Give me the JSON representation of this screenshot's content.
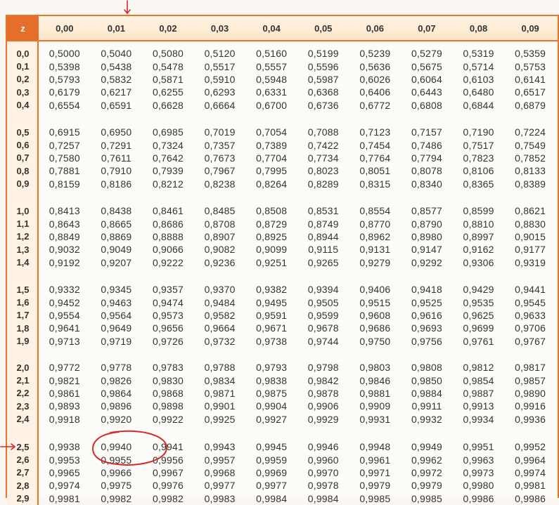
{
  "header": {
    "z_label": "z",
    "columns": [
      "0,00",
      "0,01",
      "0,02",
      "0,03",
      "0,04",
      "0,05",
      "0,06",
      "0,07",
      "0,08",
      "0,09"
    ]
  },
  "groups": [
    {
      "rows": [
        {
          "z": "0,0",
          "values": [
            "0,5000",
            "0,5040",
            "0,5080",
            "0,5120",
            "0,5160",
            "0,5199",
            "0,5239",
            "0,5279",
            "0,5319",
            "0,5359"
          ]
        },
        {
          "z": "0,1",
          "values": [
            "0,5398",
            "0,5438",
            "0,5478",
            "0,5517",
            "0,5557",
            "0,5596",
            "0,5636",
            "0,5675",
            "0,5714",
            "0,5753"
          ]
        },
        {
          "z": "0,2",
          "values": [
            "0,5793",
            "0,5832",
            "0,5871",
            "0,5910",
            "0,5948",
            "0,5987",
            "0,6026",
            "0,6064",
            "0,6103",
            "0,6141"
          ]
        },
        {
          "z": "0,3",
          "values": [
            "0,6179",
            "0,6217",
            "0,6255",
            "0,6293",
            "0,6331",
            "0,6368",
            "0,6406",
            "0,6443",
            "0,6480",
            "0,6517"
          ]
        },
        {
          "z": "0,4",
          "values": [
            "0,6554",
            "0,6591",
            "0,6628",
            "0,6664",
            "0,6700",
            "0,6736",
            "0,6772",
            "0,6808",
            "0,6844",
            "0,6879"
          ]
        }
      ]
    },
    {
      "rows": [
        {
          "z": "0,5",
          "values": [
            "0,6915",
            "0,6950",
            "0,6985",
            "0,7019",
            "0,7054",
            "0,7088",
            "0,7123",
            "0,7157",
            "0,7190",
            "0,7224"
          ]
        },
        {
          "z": "0,6",
          "values": [
            "0,7257",
            "0,7291",
            "0,7324",
            "0,7357",
            "0,7389",
            "0,7422",
            "0,7454",
            "0,7486",
            "0,7517",
            "0,7549"
          ]
        },
        {
          "z": "0,7",
          "values": [
            "0,7580",
            "0,7611",
            "0,7642",
            "0,7673",
            "0,7704",
            "0,7734",
            "0,7764",
            "0,7794",
            "0,7823",
            "0,7852"
          ]
        },
        {
          "z": "0,8",
          "values": [
            "0,7881",
            "0,7910",
            "0,7939",
            "0,7967",
            "0,7995",
            "0,8023",
            "0,8051",
            "0,8078",
            "0,8106",
            "0,8133"
          ]
        },
        {
          "z": "0,9",
          "values": [
            "0,8159",
            "0,8186",
            "0,8212",
            "0,8238",
            "0,8264",
            "0,8289",
            "0,8315",
            "0,8340",
            "0,8365",
            "0,8389"
          ]
        }
      ]
    },
    {
      "rows": [
        {
          "z": "1,0",
          "values": [
            "0,8413",
            "0,8438",
            "0,8461",
            "0,8485",
            "0,8508",
            "0,8531",
            "0,8554",
            "0,8577",
            "0,8599",
            "0,8621"
          ]
        },
        {
          "z": "1,1",
          "values": [
            "0,8643",
            "0,8665",
            "0,8686",
            "0,8708",
            "0,8729",
            "0,8749",
            "0,8770",
            "0,8790",
            "0,8810",
            "0,8830"
          ]
        },
        {
          "z": "1,2",
          "values": [
            "0,8849",
            "0,8869",
            "0,8888",
            "0,8907",
            "0,8925",
            "0,8944",
            "0,8962",
            "0,8980",
            "0,8997",
            "0,9015"
          ]
        },
        {
          "z": "1,3",
          "values": [
            "0,9032",
            "0,9049",
            "0,9066",
            "0,9082",
            "0,9099",
            "0,9115",
            "0,9131",
            "0,9147",
            "0,9162",
            "0,9177"
          ]
        },
        {
          "z": "1,4",
          "values": [
            "0,9192",
            "0,9207",
            "0,9222",
            "0,9236",
            "0,9251",
            "0,9265",
            "0,9279",
            "0,9292",
            "0,9306",
            "0,9319"
          ]
        }
      ]
    },
    {
      "rows": [
        {
          "z": "1,5",
          "values": [
            "0,9332",
            "0,9345",
            "0,9357",
            "0,9370",
            "0,9382",
            "0,9394",
            "0,9406",
            "0,9418",
            "0,9429",
            "0,9441"
          ]
        },
        {
          "z": "1,6",
          "values": [
            "0,9452",
            "0,9463",
            "0,9474",
            "0,9484",
            "0,9495",
            "0,9505",
            "0,9515",
            "0,9525",
            "0,9535",
            "0,9545"
          ]
        },
        {
          "z": "1,7",
          "values": [
            "0,9554",
            "0,9564",
            "0,9573",
            "0,9582",
            "0,9591",
            "0,9599",
            "0,9608",
            "0,9616",
            "0,9625",
            "0,9633"
          ]
        },
        {
          "z": "1,8",
          "values": [
            "0,9641",
            "0,9649",
            "0,9656",
            "0,9664",
            "0,9671",
            "0,9678",
            "0,9686",
            "0,9693",
            "0,9699",
            "0,9706"
          ]
        },
        {
          "z": "1,9",
          "values": [
            "0,9713",
            "0,9719",
            "0,9726",
            "0,9732",
            "0,9738",
            "0,9744",
            "0,9750",
            "0,9756",
            "0,9761",
            "0,9767"
          ]
        }
      ]
    },
    {
      "rows": [
        {
          "z": "2,0",
          "values": [
            "0,9772",
            "0,9778",
            "0,9783",
            "0,9788",
            "0,9793",
            "0,9798",
            "0,9803",
            "0,9808",
            "0,9812",
            "0,9817"
          ]
        },
        {
          "z": "2,1",
          "values": [
            "0,9821",
            "0,9826",
            "0,9830",
            "0,9834",
            "0,9838",
            "0,9842",
            "0,9846",
            "0,9850",
            "0,9854",
            "0,9857"
          ]
        },
        {
          "z": "2,2",
          "values": [
            "0,9861",
            "0,9864",
            "0,9868",
            "0,9871",
            "0,9875",
            "0,9878",
            "0,9881",
            "0,9884",
            "0,9887",
            "0,9890"
          ]
        },
        {
          "z": "2,3",
          "values": [
            "0,9893",
            "0,9896",
            "0,9898",
            "0,9901",
            "0,9904",
            "0,9906",
            "0,9909",
            "0,9911",
            "0,9913",
            "0,9916"
          ]
        },
        {
          "z": "2,4",
          "values": [
            "0,9918",
            "0,9920",
            "0,9922",
            "0,9925",
            "0,9927",
            "0,9929",
            "0,9931",
            "0,9932",
            "0,9934",
            "0,9936"
          ]
        }
      ]
    },
    {
      "rows": [
        {
          "z": "2,5",
          "values": [
            "0,9938",
            "0,9940",
            "0,9941",
            "0,9943",
            "0,9945",
            "0,9946",
            "0,9948",
            "0,9949",
            "0,9951",
            "0,9952"
          ]
        },
        {
          "z": "2,6",
          "values": [
            "0,9953",
            "0,9955",
            "0,9956",
            "0,9957",
            "0,9959",
            "0,9960",
            "0,9961",
            "0,9962",
            "0,9963",
            "0,9964"
          ]
        },
        {
          "z": "2,7",
          "values": [
            "0,9965",
            "0,9966",
            "0,9967",
            "0,9968",
            "0,9969",
            "0,9970",
            "0,9971",
            "0,9972",
            "0,9973",
            "0,9974"
          ]
        },
        {
          "z": "2,8",
          "values": [
            "0,9974",
            "0,9975",
            "0,9976",
            "0,9977",
            "0,9977",
            "0,9978",
            "0,9979",
            "0,9979",
            "0,9980",
            "0,9981"
          ]
        },
        {
          "z": "2,9",
          "values": [
            "0,9981",
            "0,9982",
            "0,9982",
            "0,9983",
            "0,9984",
            "0,9984",
            "0,9985",
            "0,9985",
            "0,9986",
            "0,9986"
          ]
        }
      ]
    }
  ],
  "colors": {
    "accent_orange": "#e9752a",
    "annotation_red": "#d42a2a"
  }
}
